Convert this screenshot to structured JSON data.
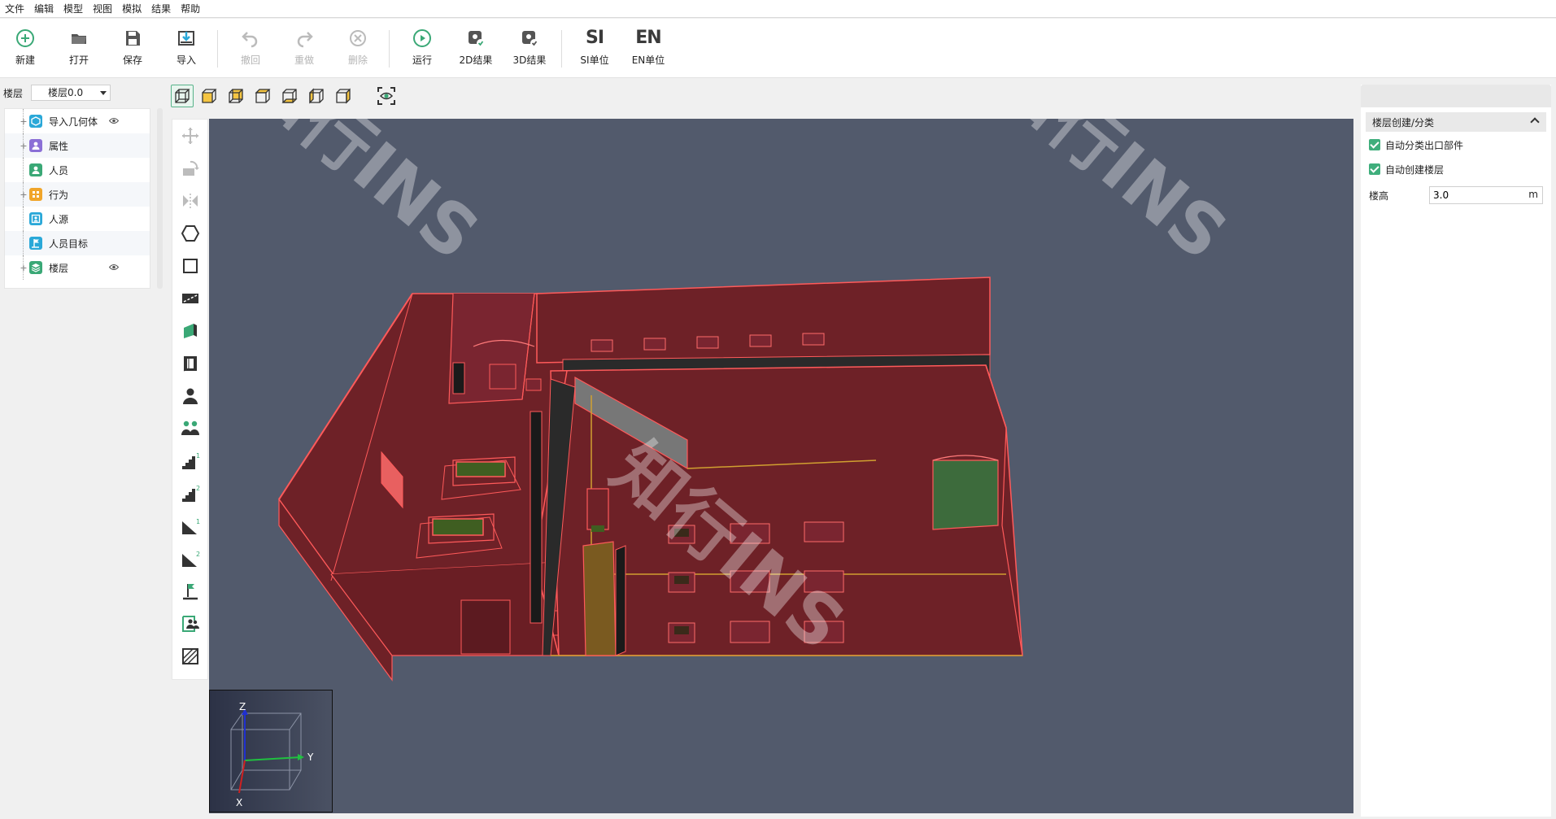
{
  "menu": [
    "文件",
    "编辑",
    "模型",
    "视图",
    "模拟",
    "结果",
    "帮助"
  ],
  "toolbar": {
    "new": "新建",
    "open": "打开",
    "save": "保存",
    "import": "导入",
    "undo": "撤回",
    "redo": "重做",
    "delete": "删除",
    "run": "运行",
    "result2d": "2D结果",
    "result3d": "3D结果",
    "si_icon_text": "SI",
    "si_unit": "SI单位",
    "en_icon_text": "EN",
    "en_unit": "EN单位"
  },
  "floor": {
    "label": "楼层",
    "selected": "楼层0.0"
  },
  "tree": {
    "items": [
      {
        "label": "导入几何体",
        "icon": "geometry-icon",
        "color": "#2aa8d8",
        "expandable": true,
        "eye": true
      },
      {
        "label": "属性",
        "icon": "property-icon",
        "color": "#8b6fd6",
        "expandable": true,
        "eye": false
      },
      {
        "label": "人员",
        "icon": "person-icon",
        "color": "#3aa876",
        "expandable": false,
        "eye": false
      },
      {
        "label": "行为",
        "icon": "behavior-icon",
        "color": "#f0a52a",
        "expandable": true,
        "eye": false
      },
      {
        "label": "人源",
        "icon": "source-icon",
        "color": "#2aa8d8",
        "expandable": false,
        "eye": false
      },
      {
        "label": "人员目标",
        "icon": "target-icon",
        "color": "#2aa8d8",
        "expandable": false,
        "eye": false
      },
      {
        "label": "楼层",
        "icon": "floor-icon",
        "color": "#3aa876",
        "expandable": true,
        "eye": true
      }
    ]
  },
  "right_panel": {
    "section_title": "楼层创建/分类",
    "auto_exit_label": "自动分类出口部件",
    "auto_floor_label": "自动创建楼层",
    "height_label": "楼高",
    "height_value": "3.0",
    "height_unit": "m"
  },
  "axis": {
    "z": "Z",
    "y": "Y",
    "x": "X"
  },
  "watermark": "知行INS",
  "colors": {
    "accent": "#3fae7c",
    "viewport_bg": "#525a6c",
    "model_fill": "#6e2127",
    "model_edge": "#ff5a5a",
    "green_panel": "#3d6b3c"
  }
}
